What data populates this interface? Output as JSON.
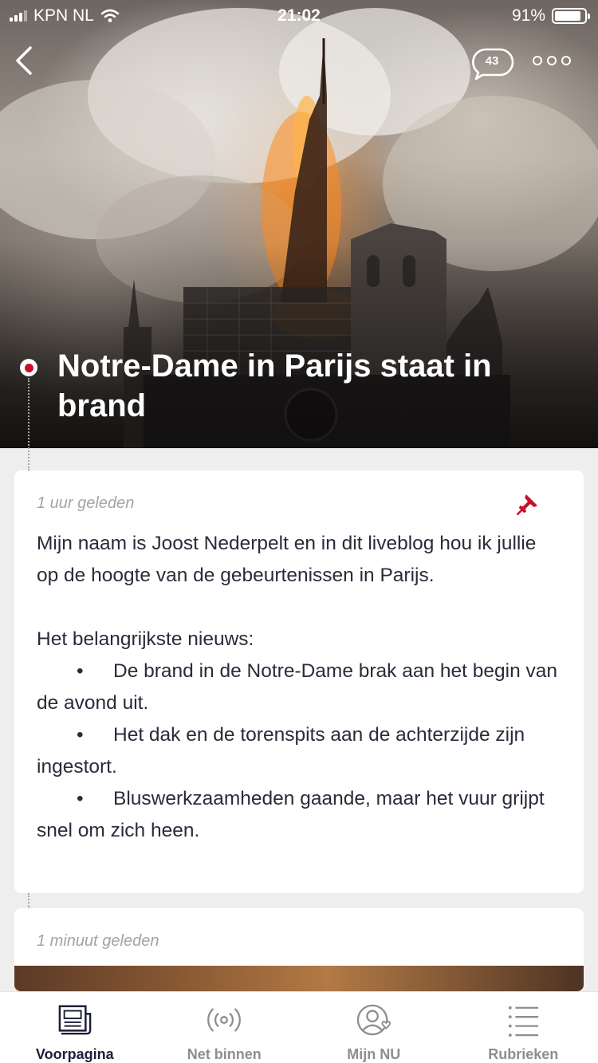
{
  "status_bar": {
    "carrier": "KPN NL",
    "time": "21:02",
    "battery": "91%",
    "battery_level": 0.91
  },
  "header": {
    "comment_count": "43",
    "back_icon": "chevron-left-icon",
    "more_icon": "more-dots-icon"
  },
  "article": {
    "title": "Notre-Dame in Parijs staat in brand"
  },
  "posts": [
    {
      "time": "1 uur geleden",
      "pinned": true,
      "intro": "Mijn naam is Joost Nederpelt en in dit liveblog hou ik jullie op de hoogte van de gebeurtenissen in Parijs.",
      "heading": "Het belangrijkste nieuws:",
      "bullets": [
        "De brand in de Notre-Dame brak aan het begin van de avond uit.",
        "Het dak en de torenspits aan de achterzijde zijn ingestort.",
        "Bluswerkzaamheden gaande, maar het vuur grijpt snel om zich heen."
      ]
    },
    {
      "time": "1 minuut geleden"
    }
  ],
  "tabbar": {
    "tabs": [
      {
        "label": "Voorpagina",
        "icon": "newspaper-icon",
        "active": true
      },
      {
        "label": "Net binnen",
        "icon": "broadcast-icon",
        "active": false
      },
      {
        "label": "Mijn NU",
        "icon": "profile-heart-icon",
        "active": false
      },
      {
        "label": "Rubrieken",
        "icon": "list-icon",
        "active": false
      }
    ]
  },
  "colors": {
    "accent": "#c8102e",
    "text": "#2a2b3a",
    "muted": "#a3a3a3",
    "tab_active": "#1c1e3a"
  }
}
